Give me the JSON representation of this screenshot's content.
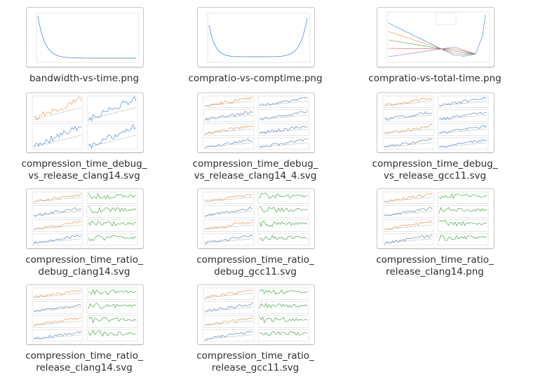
{
  "files": [
    {
      "label": "bandwidth-vs-time.png",
      "kind": "curve-down"
    },
    {
      "label": "compratio-vs-comptime.png",
      "kind": "curve-u"
    },
    {
      "label": "compratio-vs-total-time.png",
      "kind": "lines-down"
    },
    {
      "label": "compression_time_debug_\nvs_release_clang14.svg",
      "kind": "grid-noise"
    },
    {
      "label": "compression_time_debug_\nvs_release_clang14_4.svg",
      "kind": "grid-rows"
    },
    {
      "label": "compression_time_debug_\nvs_release_gcc11.svg",
      "kind": "grid-rows"
    },
    {
      "label": "compression_time_ratio_\ndebug_clang14.svg",
      "kind": "grid-green"
    },
    {
      "label": "compression_time_ratio_\ndebug_gcc11.svg",
      "kind": "grid-green"
    },
    {
      "label": "compression_time_ratio_\nrelease_clang14.png",
      "kind": "grid-green-big"
    },
    {
      "label": "compression_time_ratio_\nrelease_clang14.svg",
      "kind": "grid-green"
    },
    {
      "label": "compression_time_ratio_\nrelease_gcc11.svg",
      "kind": "grid-green"
    }
  ],
  "colors": {
    "blue": "#3b7bbf",
    "orange": "#e08a3c",
    "green": "#2e9b2e",
    "gray": "#9a9a9a"
  }
}
